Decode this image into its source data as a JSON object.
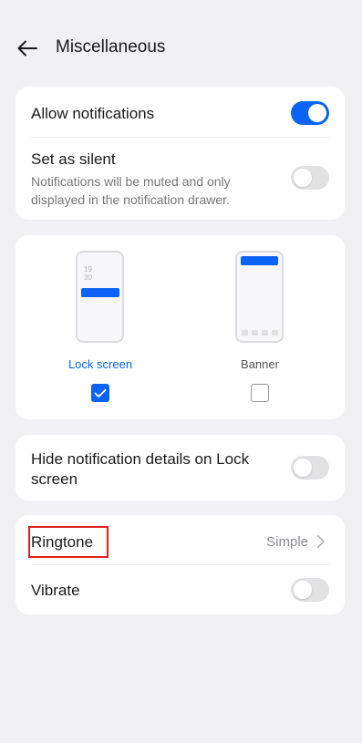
{
  "header": {
    "title": "Miscellaneous"
  },
  "notifications": {
    "allow_label": "Allow notifications",
    "allow_on": true,
    "silent_label": "Set as silent",
    "silent_desc_line1": "Notifications will be muted and only",
    "silent_desc_line2": "displayed in the notification drawer.",
    "silent_on": false
  },
  "preview": {
    "lock_clock_hour": "19",
    "lock_clock_min": "30",
    "lock_label": "Lock screen",
    "lock_checked": true,
    "banner_label": "Banner",
    "banner_checked": false
  },
  "hide_details": {
    "label_line1": "Hide notification details on Lock",
    "label_line2": "screen",
    "on": false
  },
  "sound": {
    "ringtone_label": "Ringtone",
    "ringtone_value": "Simple",
    "vibrate_label": "Vibrate",
    "vibrate_on": false
  },
  "colors": {
    "accent": "#0a63f2",
    "background": "#f1f1f4",
    "card": "#ffffff",
    "highlight": "#e02020"
  }
}
